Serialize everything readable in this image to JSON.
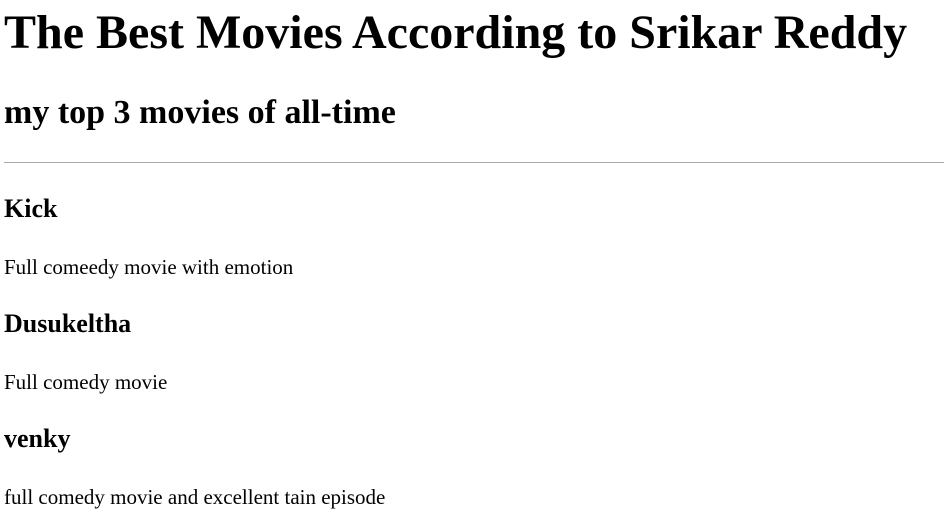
{
  "page": {
    "title": "The Best Movies According to Srikar Reddy",
    "subtitle": "my top 3 movies of all-time"
  },
  "movies": [
    {
      "title": "Kick",
      "description": "Full comeedy movie with emotion"
    },
    {
      "title": "Dusukeltha",
      "description": "Full comedy movie"
    },
    {
      "title": "venky",
      "description": "full comedy movie and excellent tain episode"
    }
  ]
}
